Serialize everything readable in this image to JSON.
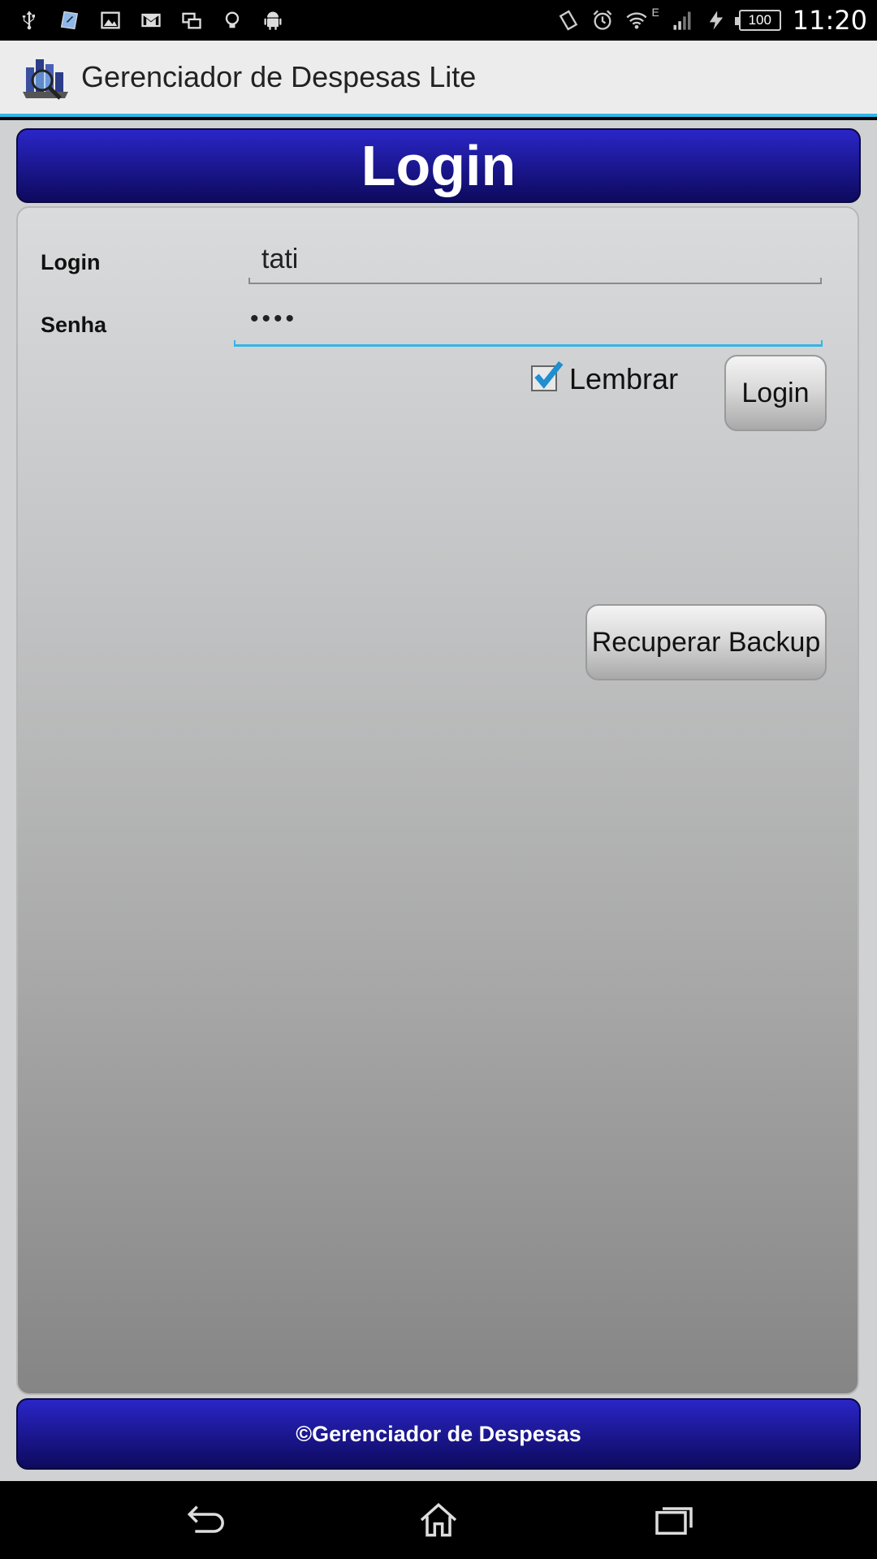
{
  "status_bar": {
    "left_icons": [
      "usb-icon",
      "notepad-icon",
      "image-icon",
      "gmail-icon",
      "screen-mirror-icon",
      "bulb-icon",
      "android-icon"
    ],
    "right_icons": [
      "vibrate-icon",
      "alarm-icon",
      "wifi-icon",
      "signal-icon",
      "charging-icon"
    ],
    "network_type": "E",
    "battery_level": "100",
    "time": "11:20"
  },
  "action_bar": {
    "title": "Gerenciador de Despesas Lite",
    "icon": "app-logo-icon"
  },
  "header": {
    "title": "Login"
  },
  "form": {
    "login_label": "Login",
    "login_value": "tati",
    "password_label": "Senha",
    "password_value": "••••",
    "remember_label": "Lembrar",
    "remember_checked": true,
    "login_button": "Login",
    "backup_button": "Recuperar Backup"
  },
  "footer": {
    "text": "©Gerenciador de Despesas"
  },
  "nav_bar": {
    "icons": [
      "back-icon",
      "home-icon",
      "recent-apps-icon"
    ]
  },
  "colors": {
    "accent": "#33b5e5",
    "banner": "#1a168c"
  }
}
